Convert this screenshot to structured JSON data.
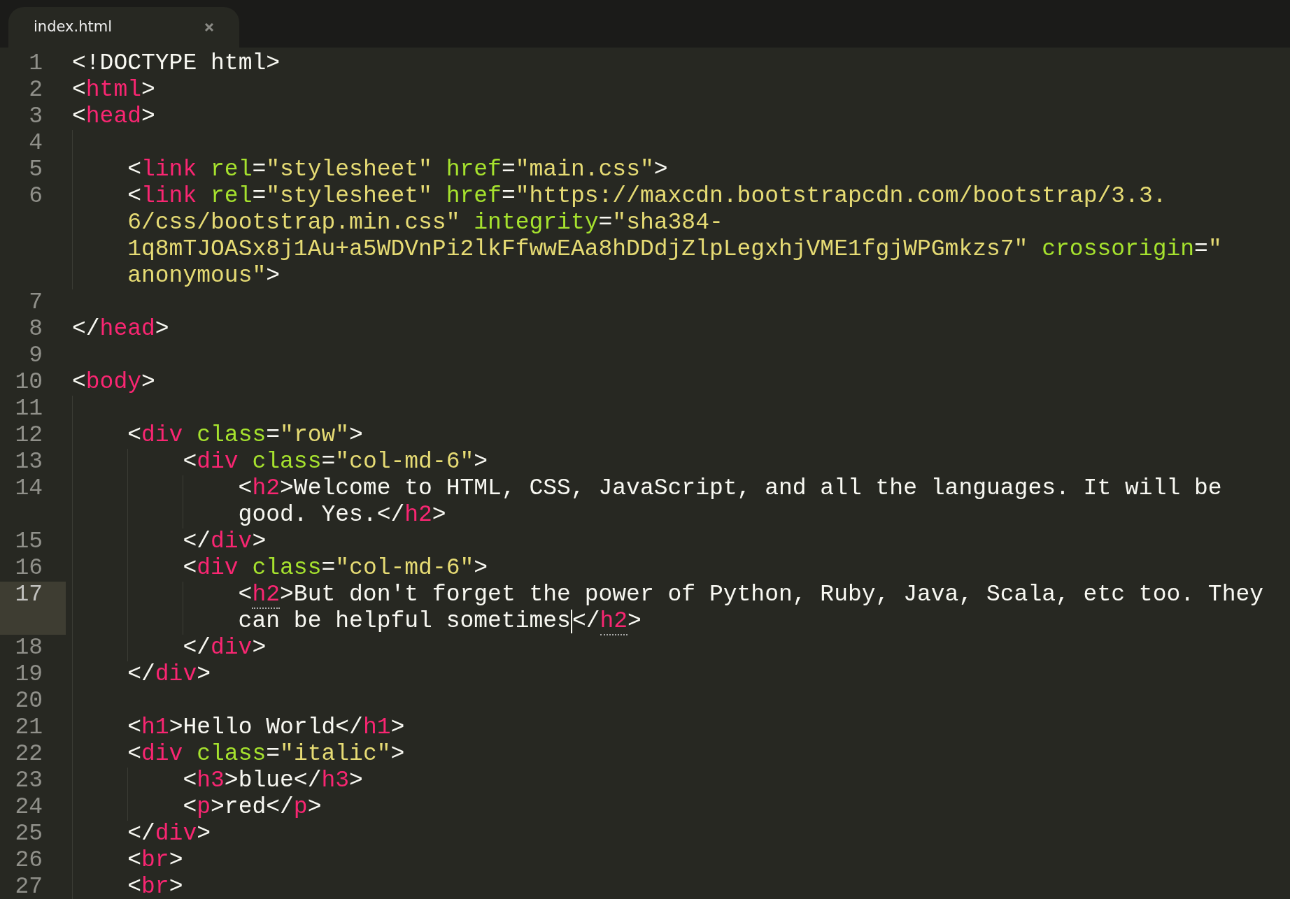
{
  "tab": {
    "label": "index.html",
    "selected": true
  },
  "lines": [
    {
      "number": "1",
      "current": false,
      "rows": [
        {
          "tokens": [
            {
              "kind": "plain",
              "text": "<!DOCTYPE html>"
            }
          ]
        }
      ]
    },
    {
      "number": "2",
      "current": false,
      "rows": [
        {
          "tokens": [
            {
              "kind": "plain",
              "text": "<"
            },
            {
              "kind": "tag",
              "text": "html",
              "matched": false
            },
            {
              "kind": "plain",
              "text": ">"
            }
          ]
        }
      ]
    },
    {
      "number": "3",
      "current": false,
      "rows": [
        {
          "tokens": [
            {
              "kind": "plain",
              "text": "<"
            },
            {
              "kind": "tag",
              "text": "head",
              "matched": false
            },
            {
              "kind": "plain",
              "text": ">"
            }
          ]
        }
      ],
      "children": [
        {
          "number": "4",
          "current": false,
          "rows": [
            {
              "tokens": []
            }
          ]
        },
        {
          "number": "5",
          "current": false,
          "rows": [
            {
              "tokens": [
                {
                  "kind": "plain",
                  "text": "<"
                },
                {
                  "kind": "tag",
                  "text": "link",
                  "matched": false
                },
                {
                  "kind": "attr",
                  "text": " rel"
                },
                {
                  "kind": "plain",
                  "text": "="
                },
                {
                  "kind": "string",
                  "text": "\"stylesheet\""
                },
                {
                  "kind": "attr",
                  "text": " href"
                },
                {
                  "kind": "plain",
                  "text": "="
                },
                {
                  "kind": "string",
                  "text": "\"main.css\""
                },
                {
                  "kind": "plain",
                  "text": ">"
                }
              ]
            }
          ]
        },
        {
          "number": "6",
          "current": false,
          "rows": [
            {
              "tokens": [
                {
                  "kind": "plain",
                  "text": "<"
                },
                {
                  "kind": "tag",
                  "text": "link",
                  "matched": false
                },
                {
                  "kind": "attr",
                  "text": " rel"
                },
                {
                  "kind": "plain",
                  "text": "="
                },
                {
                  "kind": "string",
                  "text": "\"stylesheet\""
                },
                {
                  "kind": "attr",
                  "text": " href"
                },
                {
                  "kind": "plain",
                  "text": "="
                },
                {
                  "kind": "string",
                  "text": "\"https://maxcdn.bootstrapcdn.com/bootstrap/3.3."
                }
              ]
            },
            {
              "tokens": [
                {
                  "kind": "string",
                  "text": "6/css/bootstrap.min.css\""
                },
                {
                  "kind": "attr",
                  "text": " integrity"
                },
                {
                  "kind": "plain",
                  "text": "="
                },
                {
                  "kind": "string",
                  "text": "\"sha384-"
                }
              ]
            },
            {
              "tokens": [
                {
                  "kind": "string",
                  "text": "1q8mTJOASx8j1Au+a5WDVnPi2lkFfwwEAa8hDDdjZlpLegxhjVME1fgjWPGmkzs7\""
                },
                {
                  "kind": "attr",
                  "text": " crossorigin"
                },
                {
                  "kind": "plain",
                  "text": "="
                },
                {
                  "kind": "string",
                  "text": "\""
                }
              ]
            },
            {
              "tokens": [
                {
                  "kind": "string",
                  "text": "anonymous\""
                },
                {
                  "kind": "plain",
                  "text": ">"
                }
              ]
            }
          ]
        }
      ]
    },
    {
      "number": "7",
      "current": false,
      "rows": [
        {
          "tokens": []
        }
      ]
    },
    {
      "number": "8",
      "current": false,
      "rows": [
        {
          "tokens": [
            {
              "kind": "plain",
              "text": "</"
            },
            {
              "kind": "tag",
              "text": "head",
              "matched": false
            },
            {
              "kind": "plain",
              "text": ">"
            }
          ]
        }
      ]
    },
    {
      "number": "9",
      "current": false,
      "rows": [
        {
          "tokens": []
        }
      ]
    },
    {
      "number": "10",
      "current": false,
      "rows": [
        {
          "tokens": [
            {
              "kind": "plain",
              "text": "<"
            },
            {
              "kind": "tag",
              "text": "body",
              "matched": false
            },
            {
              "kind": "plain",
              "text": ">"
            }
          ]
        }
      ],
      "children": [
        {
          "number": "11",
          "current": false,
          "rows": [
            {
              "tokens": []
            }
          ]
        },
        {
          "number": "12",
          "current": false,
          "rows": [
            {
              "tokens": [
                {
                  "kind": "plain",
                  "text": "<"
                },
                {
                  "kind": "tag",
                  "text": "div",
                  "matched": false
                },
                {
                  "kind": "attr",
                  "text": " class"
                },
                {
                  "kind": "plain",
                  "text": "="
                },
                {
                  "kind": "string",
                  "text": "\"row\""
                },
                {
                  "kind": "plain",
                  "text": ">"
                }
              ]
            }
          ],
          "children": [
            {
              "number": "13",
              "current": false,
              "rows": [
                {
                  "tokens": [
                    {
                      "kind": "plain",
                      "text": "<"
                    },
                    {
                      "kind": "tag",
                      "text": "div",
                      "matched": false
                    },
                    {
                      "kind": "attr",
                      "text": " class"
                    },
                    {
                      "kind": "plain",
                      "text": "="
                    },
                    {
                      "kind": "string",
                      "text": "\"col-md-6\""
                    },
                    {
                      "kind": "plain",
                      "text": ">"
                    }
                  ]
                }
              ],
              "children": [
                {
                  "number": "14",
                  "current": false,
                  "rows": [
                    {
                      "tokens": [
                        {
                          "kind": "plain",
                          "text": "<"
                        },
                        {
                          "kind": "tag",
                          "text": "h2",
                          "matched": false
                        },
                        {
                          "kind": "plain",
                          "text": ">Welcome to HTML, CSS, JavaScript, and all the languages. It will be"
                        }
                      ]
                    },
                    {
                      "tokens": [
                        {
                          "kind": "plain",
                          "text": "good. Yes.</"
                        },
                        {
                          "kind": "tag",
                          "text": "h2",
                          "matched": false
                        },
                        {
                          "kind": "plain",
                          "text": ">"
                        }
                      ]
                    }
                  ]
                }
              ]
            },
            {
              "number": "15",
              "current": false,
              "rows": [
                {
                  "tokens": [
                    {
                      "kind": "plain",
                      "text": "</"
                    },
                    {
                      "kind": "tag",
                      "text": "div",
                      "matched": false
                    },
                    {
                      "kind": "plain",
                      "text": ">"
                    }
                  ]
                }
              ]
            },
            {
              "number": "16",
              "current": false,
              "rows": [
                {
                  "tokens": [
                    {
                      "kind": "plain",
                      "text": "<"
                    },
                    {
                      "kind": "tag",
                      "text": "div",
                      "matched": false
                    },
                    {
                      "kind": "attr",
                      "text": " class"
                    },
                    {
                      "kind": "plain",
                      "text": "="
                    },
                    {
                      "kind": "string",
                      "text": "\"col-md-6\""
                    },
                    {
                      "kind": "plain",
                      "text": ">"
                    }
                  ]
                }
              ],
              "children": [
                {
                  "number": "17",
                  "current": true,
                  "rows": [
                    {
                      "tokens": [
                        {
                          "kind": "plain",
                          "text": "<"
                        },
                        {
                          "kind": "tag",
                          "text": "h2",
                          "matched": true
                        },
                        {
                          "kind": "plain",
                          "text": ">But don't forget the power of Python, Ruby, Java, Scala, etc too. They"
                        }
                      ]
                    },
                    {
                      "tokens": [
                        {
                          "kind": "plain",
                          "text": "can be helpful sometimes"
                        },
                        {
                          "kind": "cursor"
                        },
                        {
                          "kind": "plain",
                          "text": "</"
                        },
                        {
                          "kind": "tag",
                          "text": "h2",
                          "matched": true
                        },
                        {
                          "kind": "plain",
                          "text": ">"
                        }
                      ]
                    }
                  ]
                }
              ]
            },
            {
              "number": "18",
              "current": false,
              "rows": [
                {
                  "tokens": [
                    {
                      "kind": "plain",
                      "text": "</"
                    },
                    {
                      "kind": "tag",
                      "text": "div",
                      "matched": false
                    },
                    {
                      "kind": "plain",
                      "text": ">"
                    }
                  ]
                }
              ]
            }
          ]
        },
        {
          "number": "19",
          "current": false,
          "rows": [
            {
              "tokens": [
                {
                  "kind": "plain",
                  "text": "</"
                },
                {
                  "kind": "tag",
                  "text": "div",
                  "matched": false
                },
                {
                  "kind": "plain",
                  "text": ">"
                }
              ]
            }
          ]
        },
        {
          "number": "20",
          "current": false,
          "rows": [
            {
              "tokens": []
            }
          ]
        },
        {
          "number": "21",
          "current": false,
          "rows": [
            {
              "tokens": [
                {
                  "kind": "plain",
                  "text": "<"
                },
                {
                  "kind": "tag",
                  "text": "h1",
                  "matched": false
                },
                {
                  "kind": "plain",
                  "text": ">Hello World</"
                },
                {
                  "kind": "tag",
                  "text": "h1",
                  "matched": false
                },
                {
                  "kind": "plain",
                  "text": ">"
                }
              ]
            }
          ]
        },
        {
          "number": "22",
          "current": false,
          "rows": [
            {
              "tokens": [
                {
                  "kind": "plain",
                  "text": "<"
                },
                {
                  "kind": "tag",
                  "text": "div",
                  "matched": false
                },
                {
                  "kind": "attr",
                  "text": " class"
                },
                {
                  "kind": "plain",
                  "text": "="
                },
                {
                  "kind": "string",
                  "text": "\"italic\""
                },
                {
                  "kind": "plain",
                  "text": ">"
                }
              ]
            }
          ],
          "children": [
            {
              "number": "23",
              "current": false,
              "rows": [
                {
                  "tokens": [
                    {
                      "kind": "plain",
                      "text": "<"
                    },
                    {
                      "kind": "tag",
                      "text": "h3",
                      "matched": false
                    },
                    {
                      "kind": "plain",
                      "text": ">blue</"
                    },
                    {
                      "kind": "tag",
                      "text": "h3",
                      "matched": false
                    },
                    {
                      "kind": "plain",
                      "text": ">"
                    }
                  ]
                }
              ]
            },
            {
              "number": "24",
              "current": false,
              "rows": [
                {
                  "tokens": [
                    {
                      "kind": "plain",
                      "text": "<"
                    },
                    {
                      "kind": "tag",
                      "text": "p",
                      "matched": false
                    },
                    {
                      "kind": "plain",
                      "text": ">red</"
                    },
                    {
                      "kind": "tag",
                      "text": "p",
                      "matched": false
                    },
                    {
                      "kind": "plain",
                      "text": ">"
                    }
                  ]
                }
              ]
            }
          ]
        },
        {
          "number": "25",
          "current": false,
          "rows": [
            {
              "tokens": [
                {
                  "kind": "plain",
                  "text": "</"
                },
                {
                  "kind": "tag",
                  "text": "div",
                  "matched": false
                },
                {
                  "kind": "plain",
                  "text": ">"
                }
              ]
            }
          ]
        },
        {
          "number": "26",
          "current": false,
          "rows": [
            {
              "tokens": [
                {
                  "kind": "plain",
                  "text": "<"
                },
                {
                  "kind": "tag",
                  "text": "br",
                  "matched": false
                },
                {
                  "kind": "plain",
                  "text": ">"
                }
              ]
            }
          ]
        },
        {
          "number": "27",
          "current": false,
          "rows": [
            {
              "tokens": [
                {
                  "kind": "plain",
                  "text": "<"
                },
                {
                  "kind": "tag",
                  "text": "br",
                  "matched": false
                },
                {
                  "kind": "plain",
                  "text": ">"
                }
              ]
            }
          ]
        }
      ]
    }
  ]
}
